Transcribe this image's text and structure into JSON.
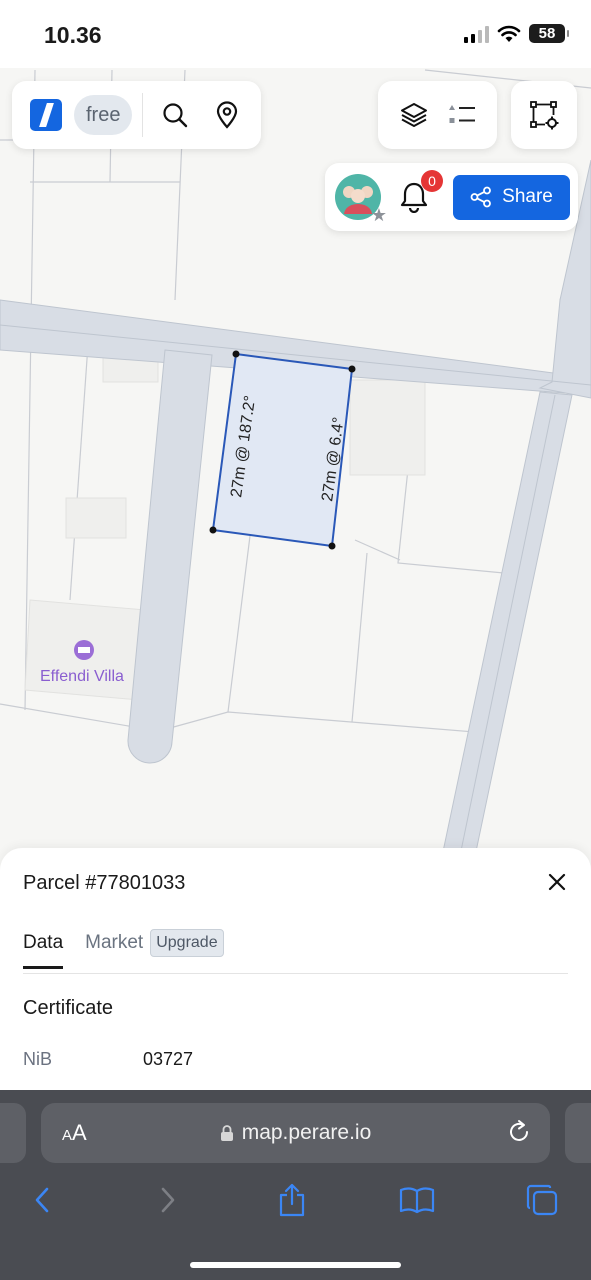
{
  "status_bar": {
    "time": "10.36",
    "battery": "58"
  },
  "toolbar": {
    "plan_badge": "free"
  },
  "notifications": {
    "count": "0"
  },
  "share_button": {
    "label": "Share"
  },
  "map": {
    "poi_label": "Effendi Villa",
    "edge_label_left": "27m @ 187.2°",
    "edge_label_right": "27m @ 6.4°"
  },
  "sheet": {
    "title": "Parcel #77801033",
    "tabs": [
      {
        "label": "Data"
      },
      {
        "label": "Market"
      }
    ],
    "upgrade_label": "Upgrade",
    "section": "Certificate",
    "rows": [
      {
        "label": "NiB",
        "value": "03727"
      }
    ]
  },
  "browser": {
    "aa_small": "A",
    "aa_large": "A",
    "url": "map.perare.io"
  },
  "colors": {
    "accent": "#1466e0",
    "badge_red": "#e53535",
    "parcel_fill": "#e1e8f4",
    "road": "#d8dde5"
  }
}
